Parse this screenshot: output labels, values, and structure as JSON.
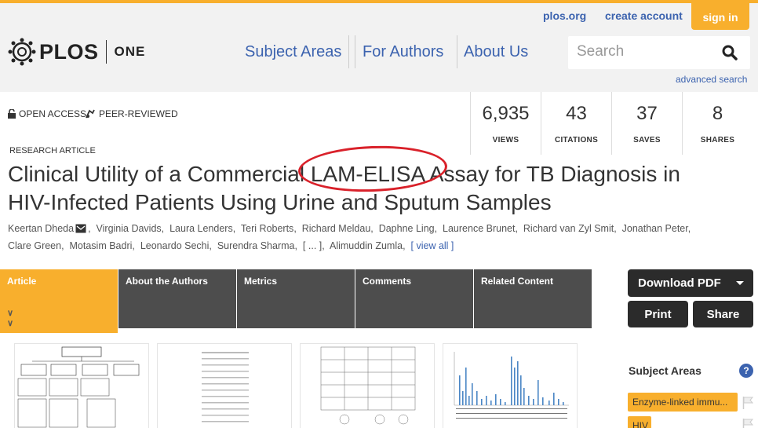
{
  "header": {
    "links": {
      "plos_org": "plos.org",
      "create_account": "create account",
      "sign_in": "sign in"
    },
    "logo": {
      "word": "PLOS",
      "journal": "ONE"
    },
    "nav": [
      "Subject Areas",
      "For Authors",
      "About Us"
    ],
    "search": {
      "placeholder": "Search",
      "advanced": "advanced search"
    }
  },
  "article": {
    "badges": {
      "open_access": "OPEN ACCESS",
      "peer_reviewed": "PEER-REVIEWED"
    },
    "metrics": [
      {
        "value": "6,935",
        "label": "VIEWS"
      },
      {
        "value": "43",
        "label": "CITATIONS"
      },
      {
        "value": "37",
        "label": "SAVES"
      },
      {
        "value": "8",
        "label": "SHARES"
      }
    ],
    "type": "RESEARCH ARTICLE",
    "title": "Clinical Utility of a Commercial LAM-ELISA Assay for TB Diagnosis in HIV-Infected Patients Using Urine and Sputum Samples",
    "authors_line1": [
      "Keertan Dheda",
      "Virginia Davids",
      "Laura Lenders",
      "Teri Roberts",
      "Richard Meldau",
      "Daphne Ling",
      "Laurence Brunet",
      "Richard van Zyl Smit",
      "Jonathan Peter,"
    ],
    "authors_line2": [
      "Clare Green",
      "Motasim Badri",
      "Leonardo Sechi",
      "Surendra Sharma,",
      "[ ... ],",
      "Alimuddin Zumla,"
    ],
    "view_all": "[ view all ]"
  },
  "tabs": [
    "Article",
    "About the Authors",
    "Metrics",
    "Comments",
    "Related Content"
  ],
  "sidebar": {
    "download": "Download PDF",
    "print": "Print",
    "share": "Share",
    "subject_areas_title": "Subject Areas",
    "help": "?",
    "subjects": [
      "Enzyme-linked immu...",
      "HIV"
    ]
  },
  "colors": {
    "accent": "#f8af2d",
    "link": "#3c63af",
    "tab_bg": "#4d4d4d",
    "annotation": "#d9212a"
  }
}
